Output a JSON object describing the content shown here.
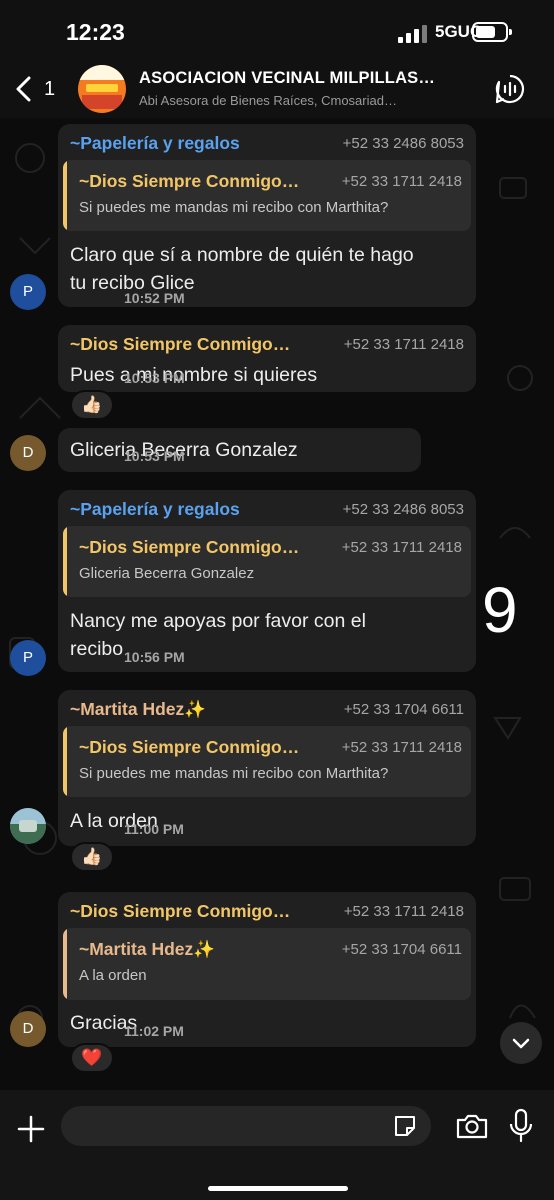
{
  "status_bar": {
    "time": "12:23",
    "network": "5GUC"
  },
  "header": {
    "back_count": "1",
    "group_name": "ASOCIACION VECINAL MILPILLAS…",
    "members": "Abi Asesora de Bienes Raíces, Cmosariad…"
  },
  "colors": {
    "blue_sender": "#5aa2ef",
    "yellow_sender": "#f2c667",
    "peach_sender": "#e8b98c",
    "bubble": "#202020"
  },
  "messages": [
    {
      "sender": "~Papelería y regalos",
      "phone": "+52 33 2486 8053",
      "quote": {
        "sender": "~Dios Siempre Conmigo…",
        "phone": "+52 33 1711 2418",
        "text": "Si puedes me mandas mi recibo con Marthita?"
      },
      "text_line1": "Claro que sí a nombre de quién te hago",
      "text_line2": "tu recibo Glice",
      "time": "10:52 PM",
      "avatar": "P"
    },
    {
      "sender": "~Dios Siempre Conmigo…",
      "phone": "+52 33 1711 2418",
      "text": "Pues a mi nombre si quieres",
      "time": "10:53 PM",
      "reaction": "👍🏻"
    },
    {
      "text": "Gliceria Becerra Gonzalez",
      "time": "10:53 PM",
      "avatar": "D"
    },
    {
      "sender": "~Papelería y regalos",
      "phone": "+52 33 2486 8053",
      "quote": {
        "sender": "~Dios Siempre Conmigo…",
        "phone": "+52 33 1711 2418",
        "text": "Gliceria Becerra Gonzalez"
      },
      "text_line1": "Nancy me apoyas por favor con el",
      "text_line2": "recibo",
      "time": "10:56 PM",
      "avatar": "P"
    },
    {
      "sender": "~Martita Hdez✨",
      "phone": "+52 33 1704 6611",
      "quote": {
        "sender": "~Dios Siempre Conmigo…",
        "phone": "+52 33 1711 2418",
        "text": "Si puedes me mandas mi recibo con Marthita?"
      },
      "text": "A la orden",
      "time": "11:00 PM",
      "reaction": "👍🏻"
    },
    {
      "sender": "~Dios Siempre Conmigo…",
      "phone": "+52 33 1711 2418",
      "quote": {
        "sender": "~Martita Hdez✨",
        "phone": "+52 33 1704 6611",
        "text": "A la orden"
      },
      "text": "Gracias",
      "time": "11:02 PM",
      "reaction": "❤️",
      "avatar": "D"
    }
  ],
  "overlay_number": "9",
  "composer": {
    "placeholder": ""
  }
}
